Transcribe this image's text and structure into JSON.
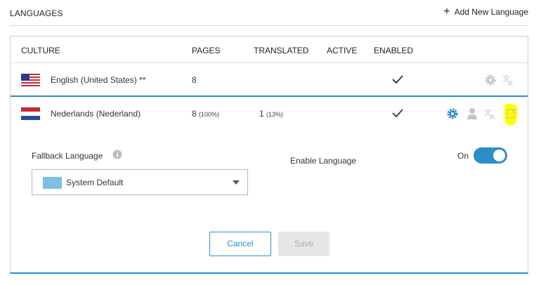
{
  "header": {
    "title": "LANGUAGES",
    "add_label": "Add New Language"
  },
  "columns": {
    "culture": "CULTURE",
    "pages": "PAGES",
    "translated": "TRANSLATED",
    "active": "ACTIVE",
    "enabled": "ENABLED"
  },
  "rows": [
    {
      "name": "English (United States) **",
      "pages": "8",
      "pages_pct": "",
      "translated": "",
      "translated_pct": "",
      "enabled": true
    },
    {
      "name": "Nederlands (Nederland)",
      "pages": "8",
      "pages_pct": "(100%)",
      "translated": "1",
      "translated_pct": "(13%)",
      "enabled": true
    }
  ],
  "details": {
    "fallback_label": "Fallback Language",
    "fallback_value": "System Default",
    "enable_label": "Enable Language",
    "toggle_state": "On"
  },
  "buttons": {
    "cancel": "Cancel",
    "save": "Save"
  },
  "colors": {
    "accent": "#2a8fc8",
    "icon_gray": "#c4c4c4",
    "highlight": "#ffff00"
  }
}
